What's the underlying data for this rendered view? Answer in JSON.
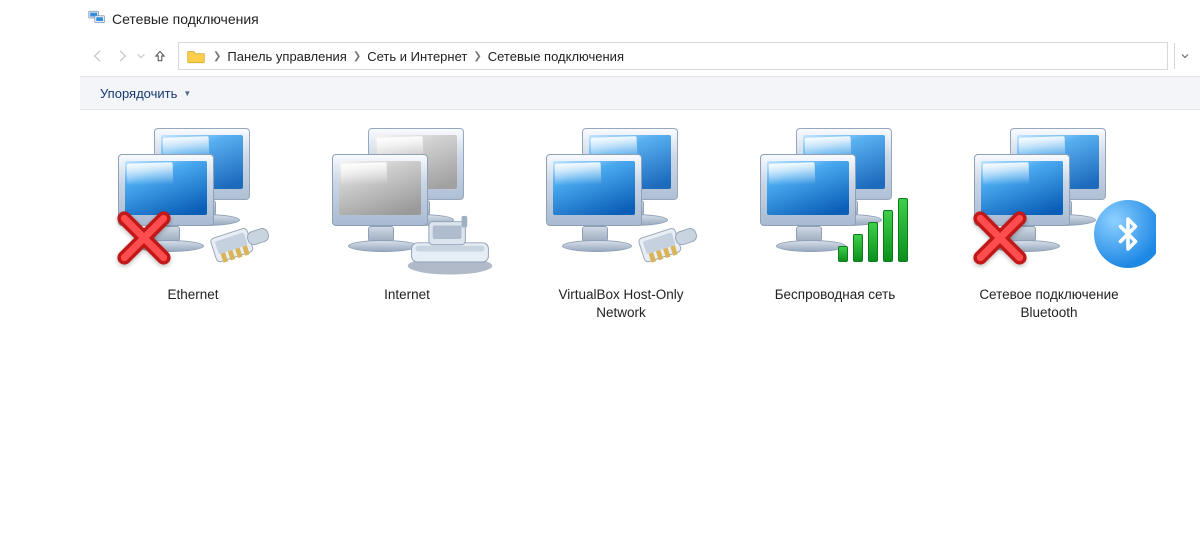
{
  "window": {
    "title": "Сетевые подключения"
  },
  "breadcrumbs": {
    "items": [
      {
        "label": "Панель управления"
      },
      {
        "label": "Сеть и Интернет"
      },
      {
        "label": "Сетевые подключения"
      }
    ]
  },
  "toolbar": {
    "organize_label": "Упорядочить"
  },
  "connections": [
    {
      "name": "Ethernet",
      "name2": "",
      "overlays": [
        "disconnected",
        "ethernet-plug"
      ]
    },
    {
      "name": "Internet",
      "name2": "",
      "overlays": [
        "dialup-modem"
      ],
      "grey": true
    },
    {
      "name": "VirtualBox Host-Only",
      "name2": "Network",
      "overlays": [
        "ethernet-plug"
      ]
    },
    {
      "name": "Беспроводная сеть",
      "name2": "",
      "overlays": [
        "wifi-bars"
      ]
    },
    {
      "name": "Сетевое подключение",
      "name2": "Bluetooth",
      "overlays": [
        "disconnected",
        "bluetooth"
      ],
      "clipped": true
    }
  ],
  "colors": {
    "screen_blue": "#1f7ed6",
    "disconnected": "#d11b1b",
    "wifi_green": "#1aa72c",
    "bluetooth": "#1e88e5",
    "title_link": "#16386f"
  }
}
